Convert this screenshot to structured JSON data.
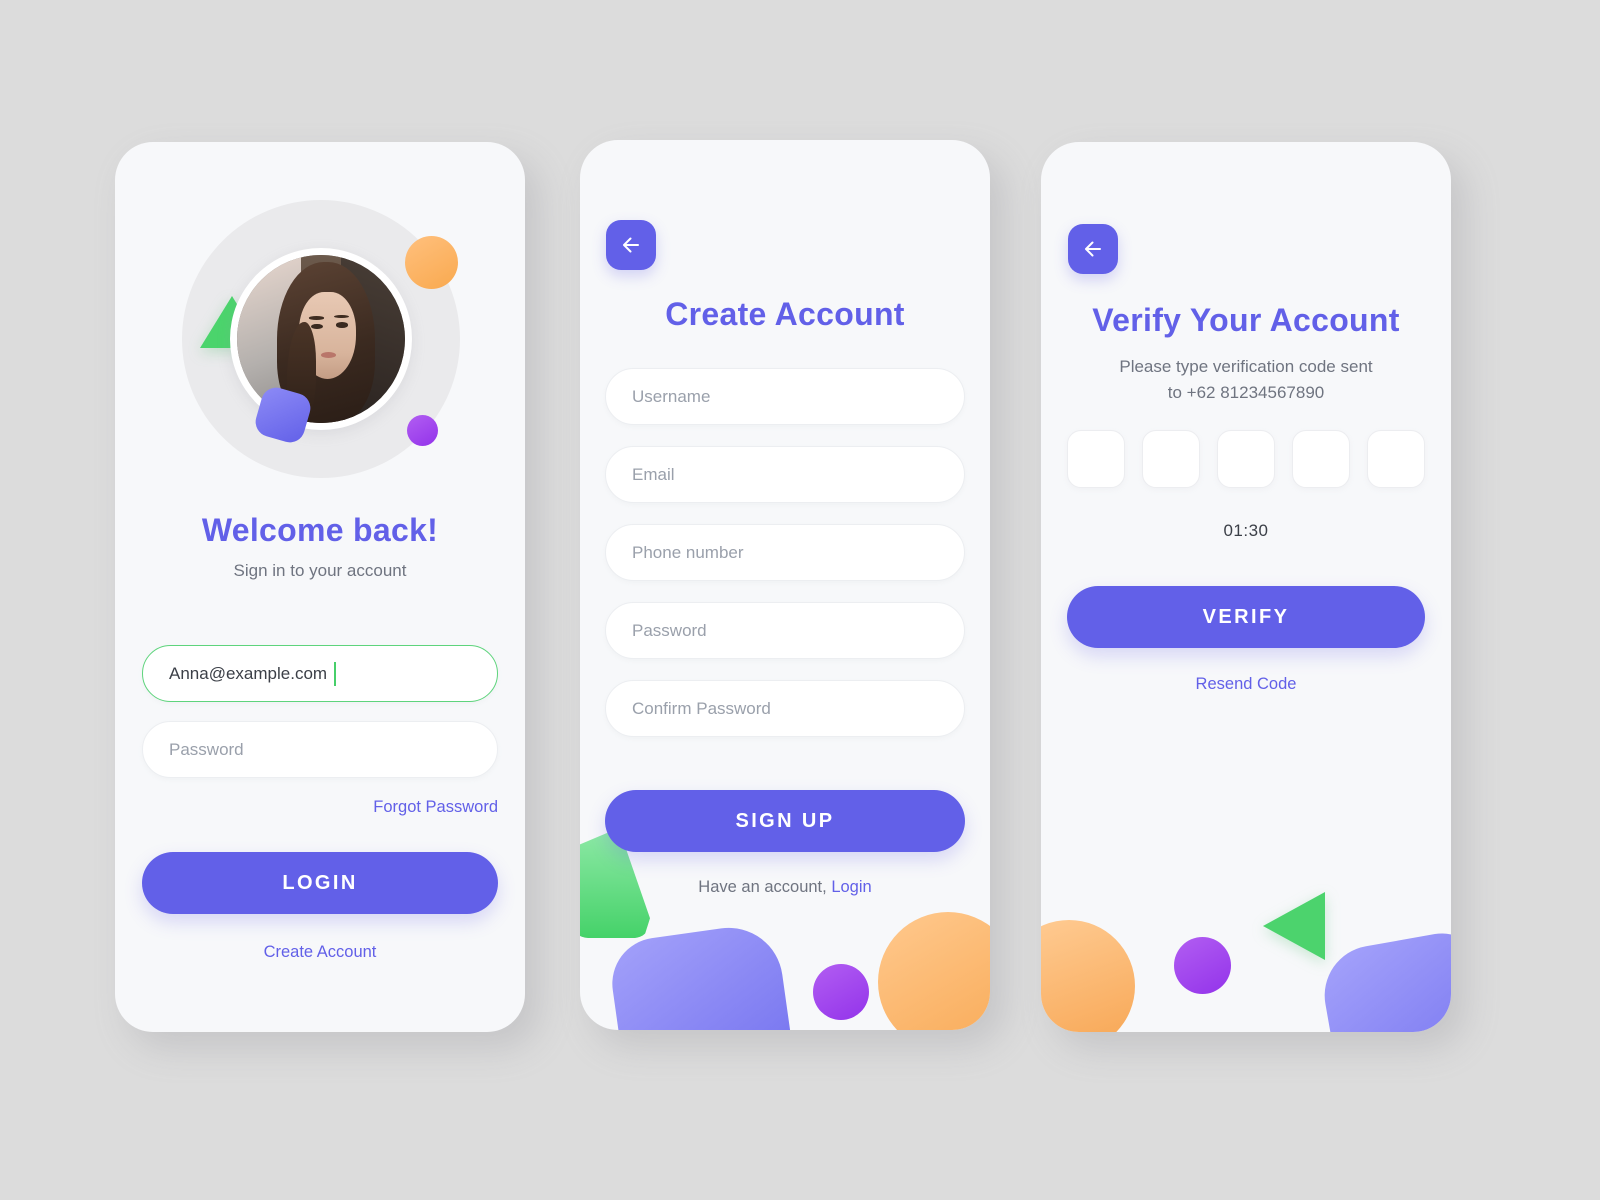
{
  "theme": {
    "accent": "#6260e8",
    "page_bg": "#dcdcdc",
    "card_bg": "#f7f8fa",
    "focus_green": "#5ed47c",
    "muted_text": "#6f7480",
    "placeholder": "#9aa0ab"
  },
  "login": {
    "avatar_alt": "user-avatar",
    "heading": "Welcome back!",
    "subheading": "Sign in to your account",
    "email_field": {
      "value": "Anna@example.com",
      "placeholder": "Email"
    },
    "password_field": {
      "value": "",
      "placeholder": "Password"
    },
    "forgot_password_label": "Forgot Password",
    "login_button_label": "LOGIN",
    "create_account_label": "Create Account"
  },
  "signup": {
    "back_icon": "arrow-left-icon",
    "heading": "Create Account",
    "fields": [
      {
        "name": "username",
        "placeholder": "Username",
        "value": ""
      },
      {
        "name": "email",
        "placeholder": "Email",
        "value": ""
      },
      {
        "name": "phone",
        "placeholder": "Phone number",
        "value": ""
      },
      {
        "name": "password",
        "placeholder": "Password",
        "value": ""
      },
      {
        "name": "confirm-password",
        "placeholder": "Confirm Password",
        "value": ""
      }
    ],
    "signup_button_label": "SIGN UP",
    "footer_text": "Have an account,",
    "footer_link_label": "Login"
  },
  "verify": {
    "back_icon": "arrow-left-icon",
    "heading": "Verify Your Account",
    "subheading_line1": "Please type verification code sent",
    "subheading_line2": "to +62 81234567890",
    "otp_cells": [
      "",
      "",
      "",
      "",
      ""
    ],
    "timer": "01:30",
    "verify_button_label": "VERIFY",
    "resend_label": "Resend Code"
  }
}
